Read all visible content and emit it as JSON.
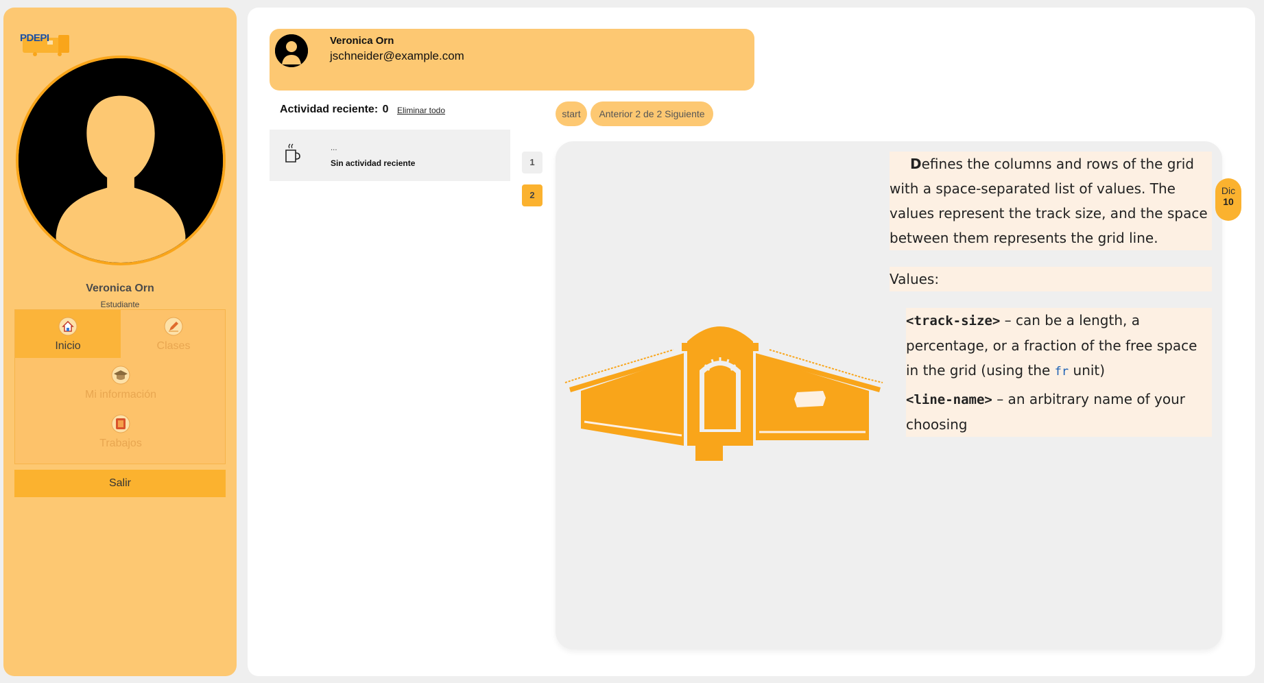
{
  "brand": {
    "logo_text": "PDEPI"
  },
  "sidebar": {
    "user_name": "Veronica Orn",
    "user_role": "Estudiante",
    "menu": [
      {
        "label": "Inicio",
        "icon": "home-icon",
        "active": true
      },
      {
        "label": "Clases",
        "icon": "pencil-icon",
        "active": false
      },
      {
        "label": "Mi información",
        "icon": "graduation-cap-icon",
        "active": false
      },
      {
        "label": "Trabajos",
        "icon": "book-icon",
        "active": false
      }
    ],
    "logout_label": "Salir"
  },
  "user_card": {
    "name": "Veronica Orn",
    "email": "jschneider@example.com"
  },
  "activity": {
    "title": "Actividad reciente:",
    "count": "0",
    "clear_label": "Eliminar todo",
    "item_dots": "...",
    "item_text": "Sin actividad reciente"
  },
  "pagination": {
    "pages": [
      "1",
      "2"
    ],
    "current": "2",
    "start_label": "start",
    "pager_label": "Anterior 2 de 2 Siguiente"
  },
  "content": {
    "dropcap": "D",
    "intro": "efines the columns and rows of the grid with a space-separated list of values. The values represent the track size, and the space between them represents the grid line.",
    "values_label": "Values:",
    "track_size_code": "<track-size>",
    "track_size_text_1": " – can be a length, a percentage, or a fraction of the free space in the grid (using the ",
    "track_size_fr": "fr",
    "track_size_text_2": " unit)",
    "line_name_code": "<line-name>",
    "line_name_text": " – an arbitrary name of your choosing",
    "date_month": "Dic",
    "date_day": "10"
  },
  "colors": {
    "accent": "#fbb22f",
    "sidebar_bg": "#fdc872",
    "building": "#f9a51a"
  }
}
